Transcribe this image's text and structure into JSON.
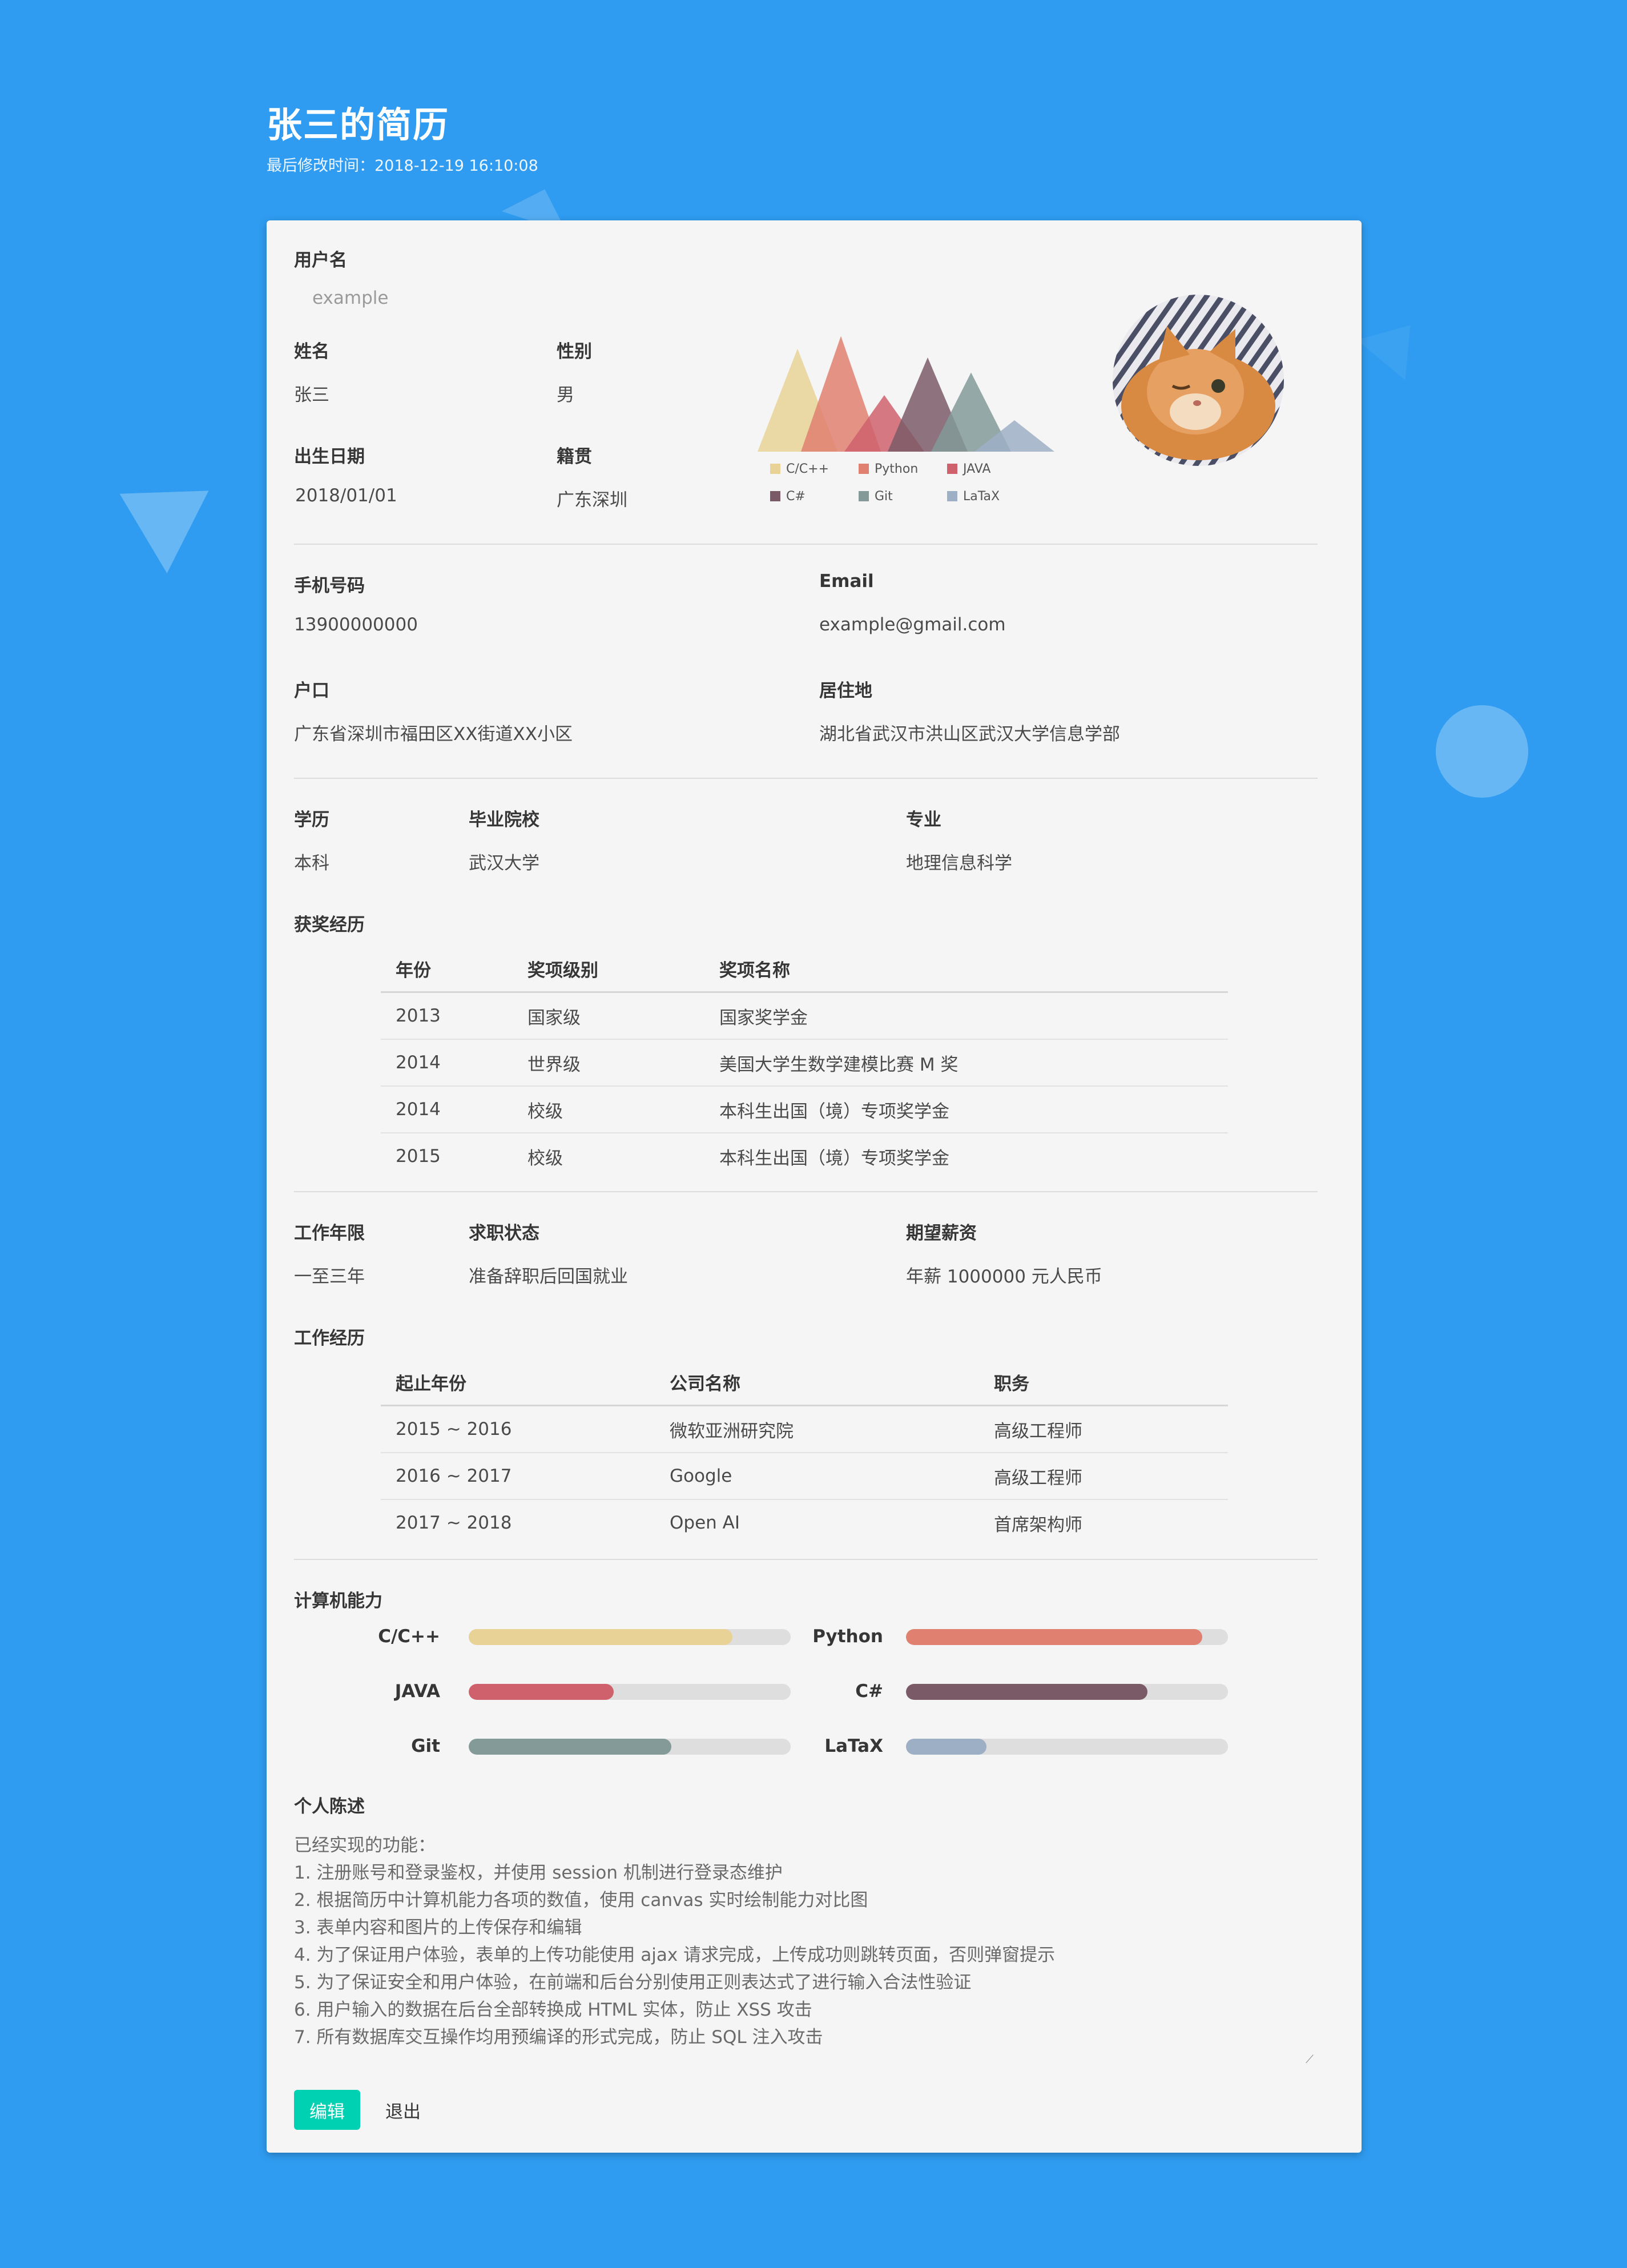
{
  "page": {
    "title": "张三的简历",
    "modified": "最后修改时间：2018-12-19 16:10:08"
  },
  "form": {
    "username_label": "用户名",
    "username_placeholder": "example",
    "name_label": "姓名",
    "name": "张三",
    "gender_label": "性别",
    "gender": "男",
    "birth_label": "出生日期",
    "birth": "2018/01/01",
    "origin_label": "籍贯",
    "origin": "广东深圳",
    "phone_label": "手机号码",
    "phone": "13900000000",
    "email_label": "Email",
    "email": "example@gmail.com",
    "hukou_label": "户口",
    "hukou": "广东省深圳市福田区XX街道XX小区",
    "residence_label": "居住地",
    "residence": "湖北省武汉市洪山区武汉大学信息学部",
    "degree_label": "学历",
    "degree": "本科",
    "school_label": "毕业院校",
    "school": "武汉大学",
    "major_label": "专业",
    "major": "地理信息科学",
    "work_years_label": "工作年限",
    "work_years": "一至三年",
    "job_status_label": "求职状态",
    "job_status": "准备辞职后回国就业",
    "salary_label": "期望薪资",
    "salary": "年薪 1000000 元人民币"
  },
  "awards": {
    "section_label": "获奖经历",
    "headers": [
      "年份",
      "奖项级别",
      "奖项名称"
    ],
    "rows": [
      [
        "2013",
        "国家级",
        "国家奖学金"
      ],
      [
        "2014",
        "世界级",
        "美国大学生数学建模比赛 M 奖"
      ],
      [
        "2014",
        "校级",
        "本科生出国（境）专项奖学金"
      ],
      [
        "2015",
        "校级",
        "本科生出国（境）专项奖学金"
      ]
    ]
  },
  "work": {
    "section_label": "工作经历",
    "headers": [
      "起止年份",
      "公司名称",
      "职务"
    ],
    "rows": [
      [
        "2015 ~ 2016",
        "微软亚洲研究院",
        "高级工程师"
      ],
      [
        "2016 ~ 2017",
        "Google",
        "高级工程师"
      ],
      [
        "2017 ~ 2018",
        "Open AI",
        "首席架构师"
      ]
    ]
  },
  "skills": {
    "section_label": "计算机能力",
    "items": [
      {
        "name": "C/C++",
        "level": 0.82,
        "color": "#e8d296"
      },
      {
        "name": "Python",
        "level": 0.92,
        "color": "#df8070"
      },
      {
        "name": "JAVA",
        "level": 0.45,
        "color": "#cf616c"
      },
      {
        "name": "C#",
        "level": 0.75,
        "color": "#7b5a67"
      },
      {
        "name": "Git",
        "level": 0.63,
        "color": "#839a99"
      },
      {
        "name": "LaTaX",
        "level": 0.25,
        "color": "#9dafc5"
      }
    ]
  },
  "chart_data": {
    "type": "area",
    "categories": [
      "C/C++",
      "Python",
      "JAVA",
      "C#",
      "Git",
      "LaTaX"
    ],
    "values": [
      0.82,
      0.92,
      0.45,
      0.75,
      0.63,
      0.25
    ],
    "colors": [
      "#e8d296",
      "#df8070",
      "#cf616c",
      "#7b5a67",
      "#839a99",
      "#9dafc5"
    ],
    "legend": [
      "C/C++",
      "Python",
      "JAVA",
      "C#",
      "Git",
      "LaTaX"
    ],
    "grid": false
  },
  "statement": {
    "section_label": "个人陈述",
    "text": "已经实现的功能：\n1. 注册账号和登录鉴权，并使用 session 机制进行登录态维护\n2. 根据简历中计算机能力各项的数值，使用 canvas 实时绘制能力对比图\n3. 表单内容和图片的上传保存和编辑\n4. 为了保证用户体验，表单的上传功能使用 ajax 请求完成，上传成功则跳转页面，否则弹窗提示\n5. 为了保证安全和用户体验，在前端和后台分别使用正则表达式了进行输入合法性验证\n6. 用户输入的数据在后台全部转换成 HTML 实体，防止 XSS 攻击\n7. 所有数据库交互操作均用预编译的形式完成，防止 SQL 注入攻击"
  },
  "buttons": {
    "edit": "编辑",
    "logout": "退出"
  }
}
